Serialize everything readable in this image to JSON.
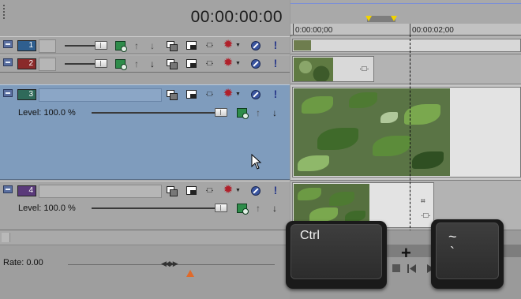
{
  "header": {
    "timecode": "00:00:00:00"
  },
  "ruler": {
    "labels": [
      "0:00:00;00",
      "00:00:02;00"
    ]
  },
  "tracks": [
    {
      "number": "1",
      "color": "#2f5f8f",
      "level": ""
    },
    {
      "number": "2",
      "color": "#8a2a2a",
      "level": ""
    },
    {
      "number": "3",
      "color": "#2f6a5a",
      "level": "Level: 100.0 %"
    },
    {
      "number": "4",
      "color": "#5a3a7a",
      "level": "Level: 100.0 %"
    }
  ],
  "track_icons": [
    "fx-icon",
    "move-up-icon",
    "move-down-icon",
    "compositing-mode-icon",
    "make-compositing-child-icon",
    "track-motion-icon",
    "track-fx-gear-icon",
    "mute-icon",
    "solo-icon"
  ],
  "footer": {
    "rate_label": "Rate: 0.00"
  },
  "keys": {
    "ctrl": "Ctrl",
    "tilde_top": "~",
    "tilde_bottom": "`",
    "plus": "+"
  },
  "colors": {
    "selected_track": "#7f9cbd",
    "loop_marker": "#f1d300",
    "rate_marker": "#e06a2a"
  }
}
